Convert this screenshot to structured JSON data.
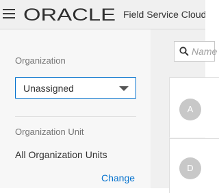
{
  "header": {
    "brand": "ORACLE",
    "app_name": "Field Service Cloud"
  },
  "sidebar": {
    "organization_label": "Organization",
    "organization_value": "Unassigned",
    "org_unit_label": "Organization Unit",
    "org_unit_value": "All Organization Units",
    "change_link": "Change"
  },
  "content": {
    "search_placeholder": "Name",
    "items": [
      {
        "initial": "A"
      },
      {
        "initial": "D"
      }
    ]
  },
  "colors": {
    "accent": "#0572ce",
    "header_bg": "#f0f0f0",
    "sidebar_bg": "#f7f7f7",
    "avatar_bg": "#c8c8c8"
  }
}
